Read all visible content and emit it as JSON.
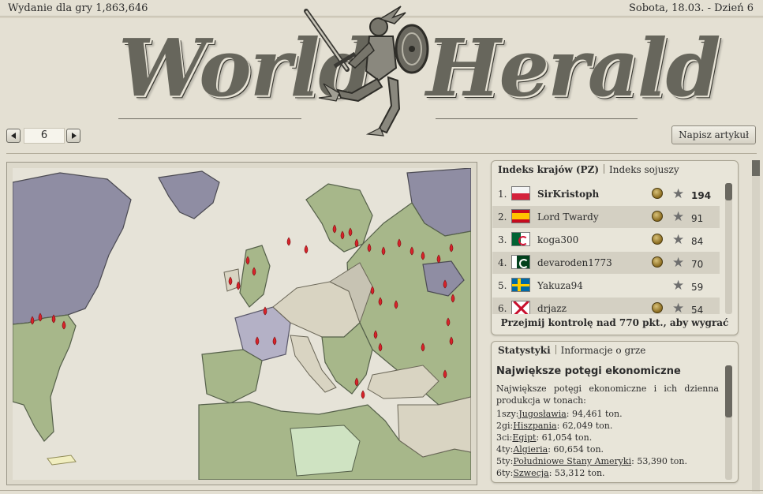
{
  "topbar": {
    "edition": "Wydanie dla gry 1,863,646",
    "date": "Sobota, 18.03. - Dzień 6"
  },
  "masthead": {
    "word_left": "World",
    "word_right": "Herald",
    "emblem": "winged-messenger-with-sword-and-shield"
  },
  "pager": {
    "value": "6"
  },
  "toolbar": {
    "write_article": "Napisz artykuł"
  },
  "colors": {
    "background": "#e4e0d3",
    "sea": "#e6e3d8",
    "land_neutral": "#d9d4c2",
    "land_green": "#a7b78a",
    "land_purple": "#8f8da3",
    "fire": "#d8232a"
  },
  "ranking": {
    "tab_active": "Indeks krajów (PZ)",
    "tab_inactive": "Indeks sojuszy",
    "rows": [
      {
        "rank": "1.",
        "flag": "flag-poland",
        "name": "SirKristoph",
        "medal": true,
        "points": "194"
      },
      {
        "rank": "2.",
        "flag": "flag-spain",
        "name": "Lord Twardy",
        "medal": true,
        "points": "91"
      },
      {
        "rank": "3.",
        "flag": "flag-algeria",
        "name": "koga300",
        "medal": true,
        "points": "84"
      },
      {
        "rank": "4.",
        "flag": "flag-pakistan",
        "name": "devaroden1773",
        "medal": true,
        "points": "70"
      },
      {
        "rank": "5.",
        "flag": "flag-sweden",
        "name": "Yakuza94",
        "medal": false,
        "points": "59"
      },
      {
        "rank": "6.",
        "flag": "flag-burgundy",
        "name": "drjazz",
        "medal": true,
        "points": "54"
      }
    ],
    "footer": "Przejmij kontrolę nad 770 pkt., aby wygrać"
  },
  "stats": {
    "tab_active": "Statystyki",
    "tab_inactive": "Informacje o grze",
    "heading": "Największe potęgi ekonomiczne",
    "intro": "Największe potęgi ekonomiczne i ich dzienna produkcja w tonach:",
    "lines": [
      {
        "place": "1szy:",
        "country": "Jugosławia",
        "value": ": 94,461 ton."
      },
      {
        "place": "2gi:",
        "country": "Hiszpania",
        "value": ": 62,049 ton."
      },
      {
        "place": "3ci:",
        "country": "Egipt",
        "value": ": 61,054 ton."
      },
      {
        "place": "4ty:",
        "country": "Algieria",
        "value": ": 60,654 ton."
      },
      {
        "place": "5ty:",
        "country": "Południowe Stany Ameryki",
        "value": ": 53,390 ton."
      },
      {
        "place": "6ty:",
        "country": "Szwecja",
        "value": ": 53,312 ton."
      }
    ]
  }
}
